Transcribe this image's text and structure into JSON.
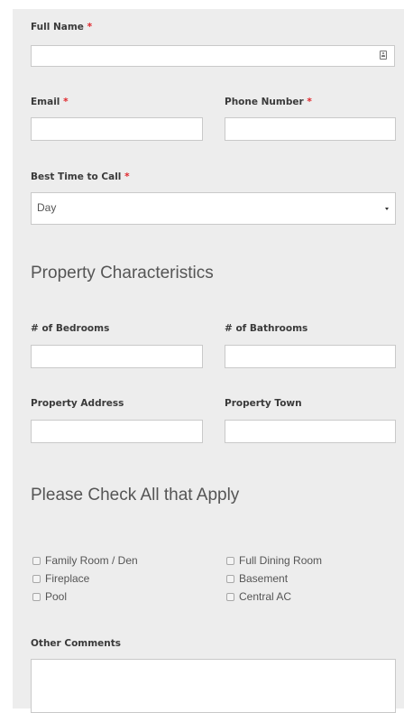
{
  "contact": {
    "full_name": {
      "label": "Full Name",
      "required_mark": "*",
      "value": "",
      "icon": "contact-card-icon"
    },
    "email": {
      "label": "Email",
      "required_mark": "*",
      "value": ""
    },
    "phone": {
      "label": "Phone Number",
      "required_mark": "*",
      "value": ""
    },
    "best_time": {
      "label": "Best Time to Call",
      "required_mark": "*",
      "selected": "Day"
    }
  },
  "property": {
    "heading": "Property Characteristics",
    "bedrooms": {
      "label": "# of Bedrooms",
      "value": ""
    },
    "bathrooms": {
      "label": "# of Bathrooms",
      "value": ""
    },
    "address": {
      "label": "Property Address",
      "value": ""
    },
    "town": {
      "label": "Property Town",
      "value": ""
    }
  },
  "amenities": {
    "heading": "Please Check All that Apply",
    "items": [
      {
        "label": "Family Room / Den",
        "checked": false
      },
      {
        "label": "Fireplace",
        "checked": false
      },
      {
        "label": "Pool",
        "checked": false
      },
      {
        "label": "Full Dining Room",
        "checked": false
      },
      {
        "label": "Basement",
        "checked": false
      },
      {
        "label": "Central AC",
        "checked": false
      }
    ]
  },
  "comments": {
    "label": "Other Comments",
    "value": ""
  },
  "colors": {
    "panel_background": "#ededed",
    "required_asterisk": "#e0262b",
    "field_border": "#c9c9c9"
  }
}
